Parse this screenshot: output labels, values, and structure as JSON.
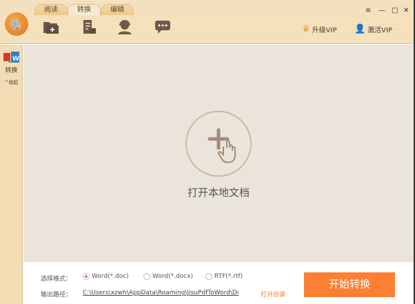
{
  "tabs": [
    {
      "label": "阅读"
    },
    {
      "label": "转换",
      "active": true
    },
    {
      "label": "编辑"
    }
  ],
  "toolbar": {
    "icons": [
      "add-folder-icon",
      "file-lock-icon",
      "customer-service-icon",
      "message-icon"
    ]
  },
  "window": {
    "menu": "≡",
    "minimize": "—",
    "maximize": "□",
    "close": "✕"
  },
  "vip": {
    "upgrade": "升级VIP",
    "activate": "激活VIP"
  },
  "sidebar": {
    "convert": "转换",
    "collapse": "收起"
  },
  "main": {
    "open_label": "打开本地文档"
  },
  "bottom": {
    "format_label": "选择格式：",
    "formats": [
      {
        "label": "Word(*.doc)",
        "selected": true
      },
      {
        "label": "Word(*.docx)",
        "selected": false
      },
      {
        "label": "RTF(*.rtf)",
        "selected": false
      }
    ],
    "path_label": "输出路径：",
    "path": "C:\\Users\\xzwh\\AppData\\Roaming\\JisuPdfToWord\\Doc C",
    "open_dir": "打开目录",
    "start": "开始转换"
  },
  "colors": {
    "accent": "#fd7f33",
    "main_bg": "#ebe4da",
    "header_bg": "#f3dfb9"
  }
}
